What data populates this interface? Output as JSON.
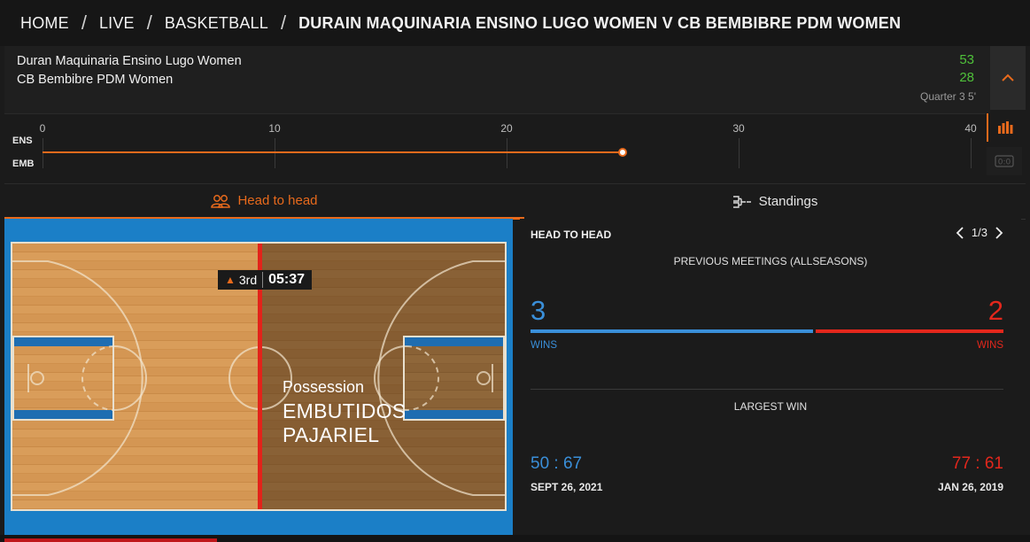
{
  "breadcrumb": {
    "items": [
      "HOME",
      "LIVE",
      "BASKETBALL"
    ],
    "current": "DURAiN MAQUINARIA ENSINO LUGO WOMEN V CB BEMBIBRE PDM WOMEN"
  },
  "scoreboard": {
    "home_team": "Duran Maquinaria Ensino Lugo Women",
    "away_team": "CB Bembibre PDM Women",
    "home_score": "53",
    "away_score": "28",
    "period_info": "Quarter 3 5'",
    "score_color": "#4fc13a",
    "toggle_icon": "chevron-up-icon"
  },
  "timeline": {
    "home_abbr": "ENS",
    "away_abbr": "EMB",
    "ticks": [
      "0",
      "10",
      "20",
      "30",
      "40"
    ],
    "progress_minutes": 25,
    "total_minutes": 40,
    "accent": "#e86a1c"
  },
  "tabs": {
    "head_to_head": "Head to head",
    "standings": "Standings",
    "active": "head_to_head"
  },
  "court": {
    "period": "3rd",
    "clock": "05:37",
    "possession_label": "Possession",
    "possession_team": "EMBUTIDOS PAJARIEL"
  },
  "h2h": {
    "title": "HEAD TO HEAD",
    "pager": "1/3",
    "previous_meetings": "PREVIOUS MEETINGS (ALLSEASONS)",
    "home_wins": "3",
    "away_wins": "2",
    "wins_label": "WINS",
    "largest_win": "LARGEST WIN",
    "home_largest": "50 : 67",
    "home_largest_date": "SEPT 26, 2021",
    "away_largest": "77 : 61",
    "away_largest_date": "JAN 26, 2019",
    "home_color": "#3a8fd9",
    "away_color": "#e3271c"
  }
}
